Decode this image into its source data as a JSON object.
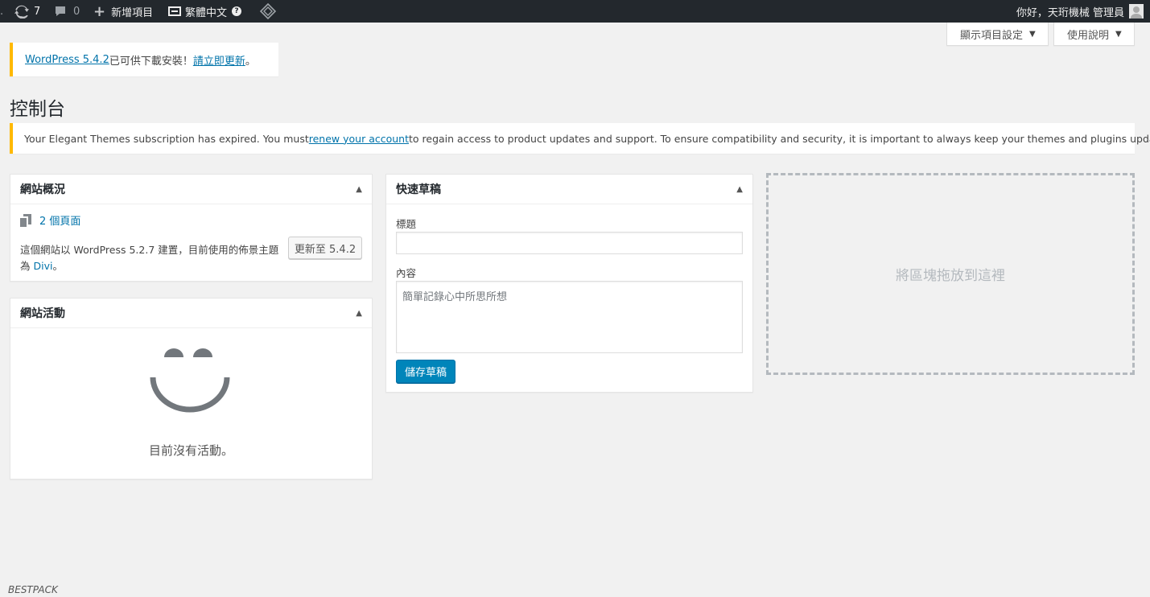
{
  "adminbar": {
    "updates_count": "7",
    "comments_count": "0",
    "new_content": "新增項目",
    "language": "繁體中文",
    "greeting": "你好，天珩機械 管理員"
  },
  "screen_meta": {
    "screen_options": "顯示項目設定",
    "help": "使用說明"
  },
  "update_notice": {
    "version_link": "WordPress 5.4.2",
    "middle_text": " 已可供下載安裝！",
    "update_link": "請立即更新",
    "end_text": "。"
  },
  "page": {
    "title": "控制台"
  },
  "elegant_notice": {
    "text_before": "Your Elegant Themes subscription has expired. You must ",
    "link": "renew your account",
    "text_after": " to regain access to product updates and support. To ensure compatibility and security, it is important to always keep your themes and plugins updated."
  },
  "at_a_glance": {
    "title": "網站概況",
    "pages": "2 個頁面",
    "version_text": "這個網站以 WordPress 5.2.7 建置，目前使用的佈景主題為 ",
    "theme_link": "Divi",
    "version_end": "。",
    "update_button": "更新至 5.4.2"
  },
  "activity": {
    "title": "網站活動",
    "empty_text": "目前沒有活動。"
  },
  "quick_draft": {
    "title": "快速草稿",
    "title_label": "標題",
    "title_value": "",
    "content_label": "內容",
    "content_placeholder": "簡單記錄心中所思所想",
    "save_button": "儲存草稿"
  },
  "dropzone": {
    "text": "將區塊拖放到這裡"
  },
  "footer": {
    "mark": "BESTPACK"
  },
  "colors": {
    "adminbar_bg": "#23282d",
    "accent": "#0073aa",
    "primary_button": "#0085ba",
    "notice_border": "#ffb900"
  }
}
